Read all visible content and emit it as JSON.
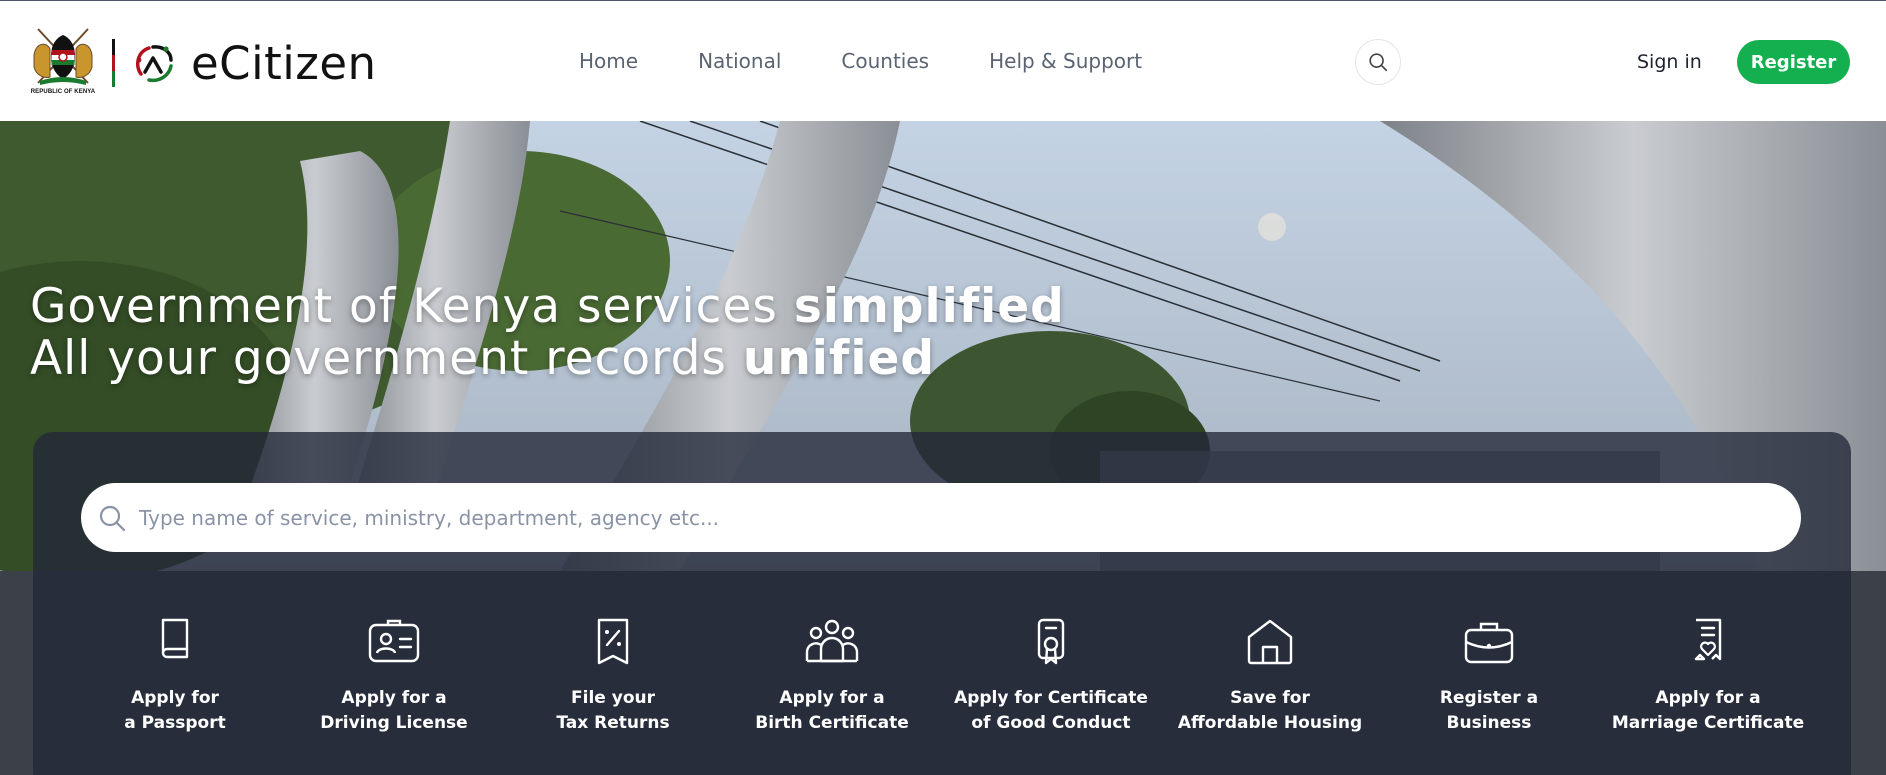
{
  "header": {
    "coat_caption": "REPUBLIC OF KENYA",
    "brand_name": "eCitizen",
    "nav": [
      "Home",
      "National",
      "Counties",
      "Help & Support"
    ],
    "search_icon": "search-icon",
    "signin_label": "Sign in",
    "register_label": "Register",
    "colors": {
      "register": "#14b050",
      "nav_text": "#5a6472"
    }
  },
  "hero": {
    "line1_regular": "Government of Kenya services ",
    "line1_bold": "simplified",
    "line2_regular": "All your government records ",
    "line2_bold": "unified",
    "search": {
      "placeholder": "Type name of service, ministry, department, agency etc...",
      "value": ""
    },
    "services": [
      {
        "icon": "passport-icon",
        "line1": "Apply for",
        "line2": "a Passport"
      },
      {
        "icon": "driving-license-icon",
        "line1": "Apply for a",
        "line2": "Driving License"
      },
      {
        "icon": "tax-receipt-icon",
        "line1": "File your",
        "line2": "Tax Returns"
      },
      {
        "icon": "family-icon",
        "line1": "Apply for a",
        "line2": "Birth Certificate"
      },
      {
        "icon": "certificate-badge-icon",
        "line1": "Apply for Certificate",
        "line2": "of Good Conduct"
      },
      {
        "icon": "house-icon",
        "line1": "Save for",
        "line2": "Affordable Housing"
      },
      {
        "icon": "briefcase-icon",
        "line1": "Register a",
        "line2": "Business"
      },
      {
        "icon": "marriage-certificate-icon",
        "line1": "Apply for a",
        "line2": "Marriage Certificate"
      }
    ]
  }
}
